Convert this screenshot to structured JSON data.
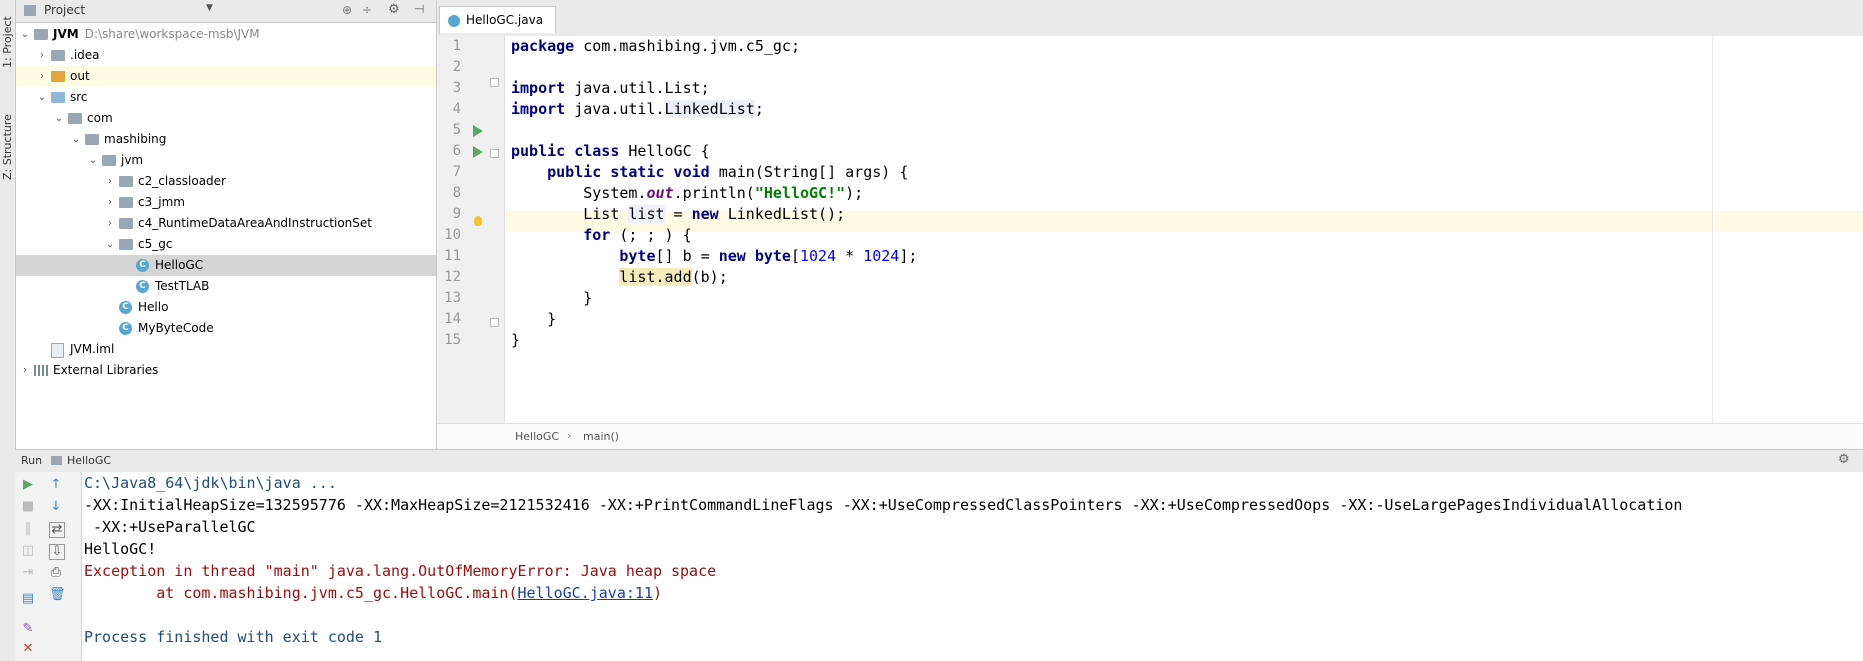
{
  "sidebar": {
    "project_tab": "1: Project",
    "structure_tab": "Z: Structure"
  },
  "project_panel": {
    "title": "Project",
    "tree": [
      {
        "label": "JVM",
        "extra": "D:\\share\\workspace-msb\\JVM",
        "depth": 0,
        "expanded": true,
        "icon": "module-folder-icon"
      },
      {
        "label": ".idea",
        "depth": 1,
        "expanded": false,
        "icon": "folder-icon"
      },
      {
        "label": "out",
        "depth": 1,
        "expanded": false,
        "icon": "folder-orange-icon"
      },
      {
        "label": "src",
        "depth": 1,
        "expanded": true,
        "icon": "source-folder-icon"
      },
      {
        "label": "com",
        "depth": 2,
        "expanded": true,
        "icon": "package-icon"
      },
      {
        "label": "mashibing",
        "depth": 3,
        "expanded": true,
        "icon": "package-icon"
      },
      {
        "label": "jvm",
        "depth": 4,
        "expanded": true,
        "icon": "package-icon"
      },
      {
        "label": "c2_classloader",
        "depth": 5,
        "expanded": false,
        "icon": "package-icon"
      },
      {
        "label": "c3_jmm",
        "depth": 5,
        "expanded": false,
        "icon": "package-icon"
      },
      {
        "label": "c4_RuntimeDataAreaAndInstructionSet",
        "depth": 5,
        "expanded": false,
        "icon": "package-icon"
      },
      {
        "label": "c5_gc",
        "depth": 5,
        "expanded": true,
        "icon": "package-icon"
      },
      {
        "label": "HelloGC",
        "depth": 6,
        "icon": "class-icon"
      },
      {
        "label": "TestTLAB",
        "depth": 6,
        "icon": "class-icon"
      },
      {
        "label": "Hello",
        "depth": 5,
        "icon": "class-icon"
      },
      {
        "label": "MyByteCode",
        "depth": 5,
        "icon": "class-icon"
      },
      {
        "label": "JVM.iml",
        "depth": 1,
        "icon": "iml-file-icon"
      },
      {
        "label": "External Libraries",
        "depth": 0,
        "expanded": false,
        "icon": "library-icon"
      }
    ]
  },
  "editor": {
    "tab_label": "HelloGC.java",
    "breadcrumb": [
      "HelloGC",
      "main()"
    ],
    "lines": [
      "1",
      "2",
      "3",
      "4",
      "5",
      "6",
      "7",
      "8",
      "9",
      "10",
      "11",
      "12",
      "13",
      "14",
      "15"
    ]
  },
  "code": {
    "l1_kw": "package",
    "l1_rest": " com.mashibing.jvm.c5_gc;",
    "l3_kw": "import",
    "l3_rest": " java.util.List;",
    "l4_kw": "import",
    "l4_a": " java.util.",
    "l4_b": "LinkedList",
    "l4_c": ";",
    "l6_kw": "public class",
    "l6_rest": " HelloGC {",
    "l7_kw": "public static void",
    "l7_rest": " main(String[] args) {",
    "l8_a": "System.",
    "l8_b": "out",
    "l8_c": ".println(",
    "l8_d": "\"HelloGC!\"",
    "l8_e": ");",
    "l9_a": "List ",
    "l9_b": "list",
    "l9_c": " = ",
    "l9_d": "new",
    "l9_e": " LinkedList();",
    "l10_kw": "for",
    "l10_rest": " (; ; ) {",
    "l11_kw": "byte",
    "l11_a": "[] b = ",
    "l11_kw2": "new byte",
    "l11_b": "[",
    "l11_n1": "1024",
    "l11_c": " * ",
    "l11_n2": "1024",
    "l11_d": "];",
    "l12_a": "list.add",
    "l12_b": "(b);",
    "l13": "}",
    "l14": "}",
    "l15": "}"
  },
  "run": {
    "label": "Run",
    "config": "HelloGC"
  },
  "console": {
    "line1": "C:\\Java8_64\\jdk\\bin\\java ...",
    "line2": "-XX:InitialHeapSize=132595776 -XX:MaxHeapSize=2121532416 -XX:+PrintCommandLineFlags -XX:+UseCompressedClassPointers -XX:+UseCompressedOops -XX:-UseLargePagesIndividualAllocation",
    "line3": " -XX:+UseParallelGC",
    "line4": "HelloGC!",
    "line5": "Exception in thread \"main\" java.lang.OutOfMemoryError: Java heap space",
    "line6_a": "\tat com.mashibing.jvm.c5_gc.HelloGC.main(",
    "line6_link": "HelloGC.java:11",
    "line6_b": ")",
    "line8": "Process finished with exit code 1"
  }
}
